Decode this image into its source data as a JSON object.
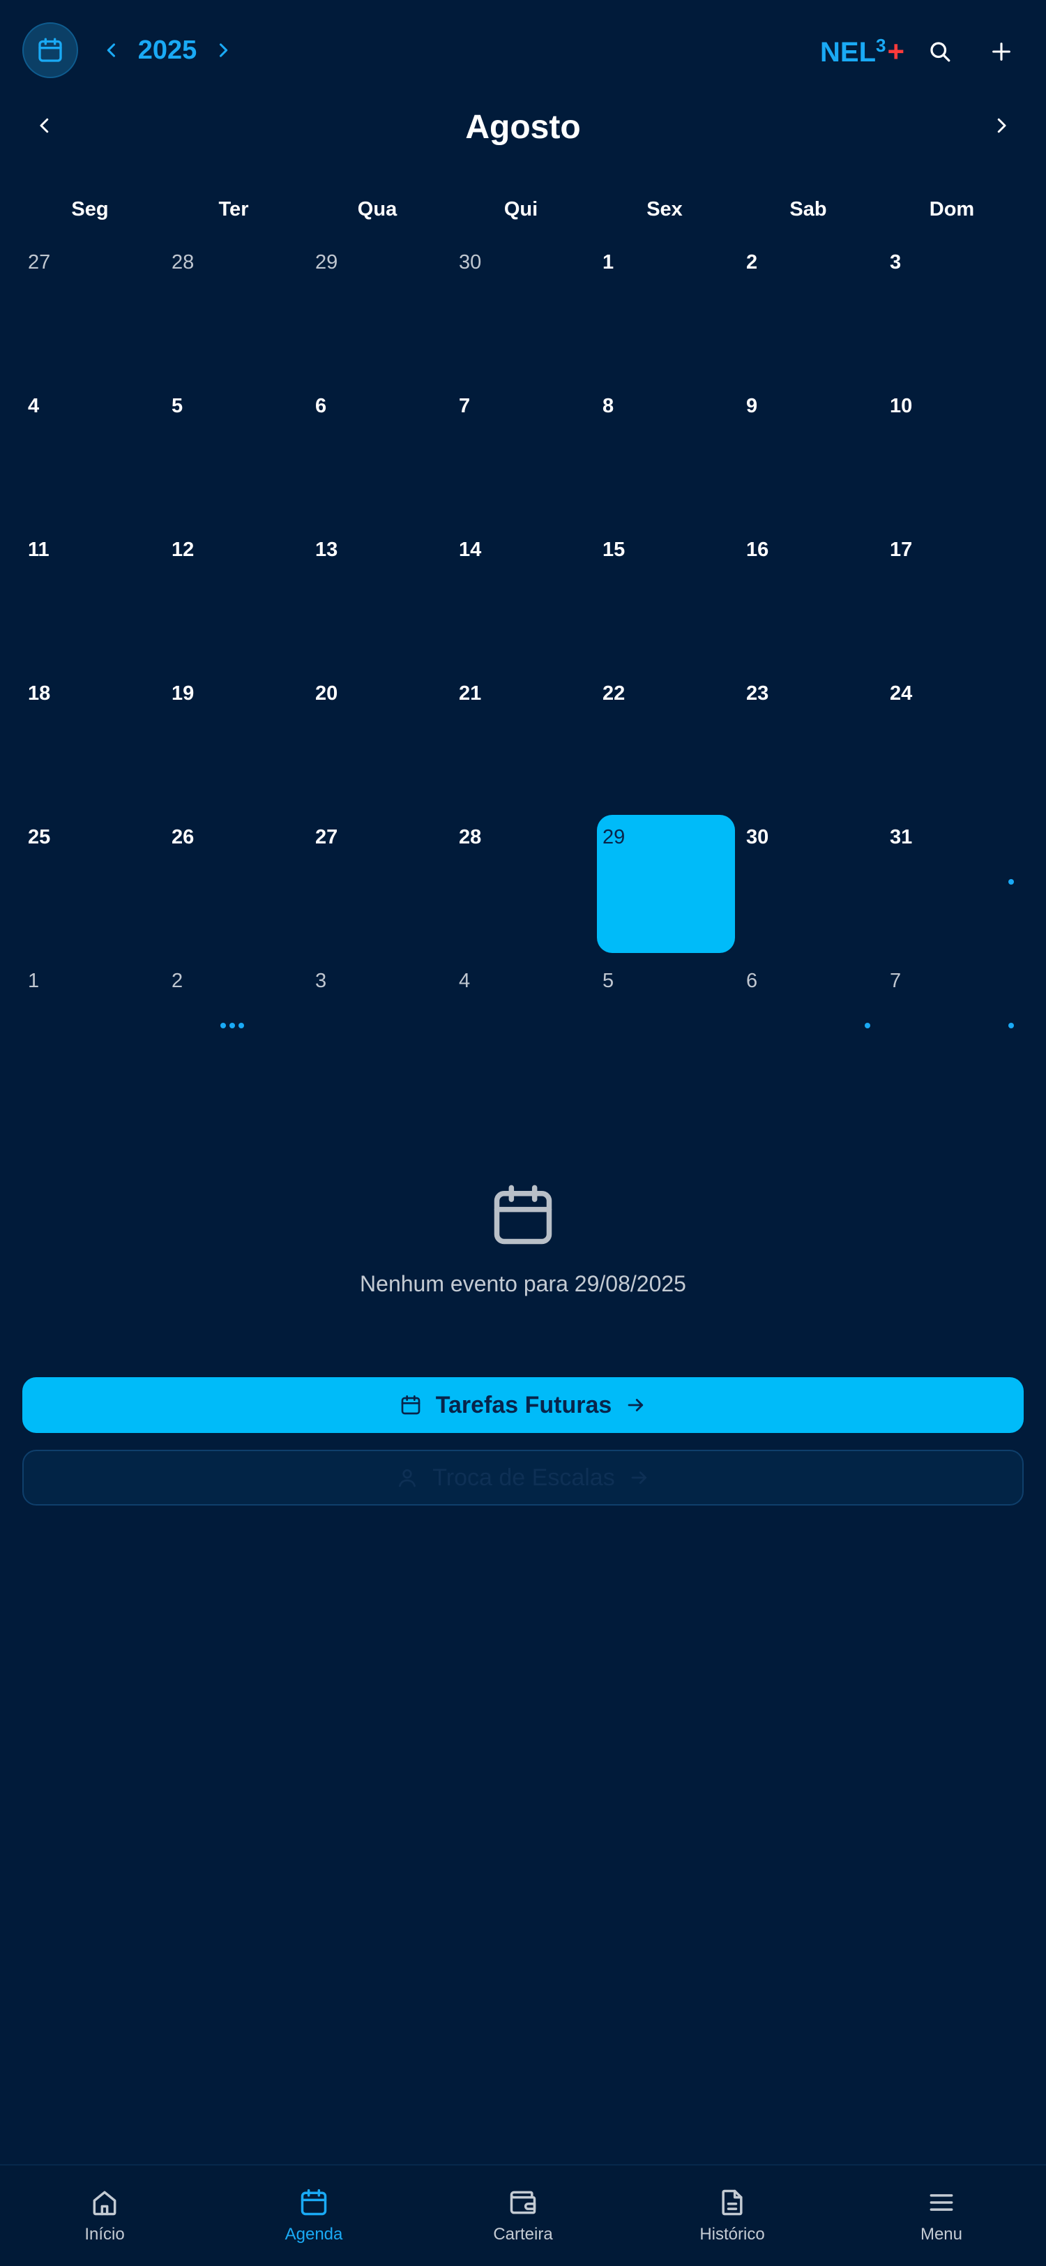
{
  "header": {
    "year": "2025",
    "brand_name": "NEL",
    "brand_sup": "3",
    "brand_plus": "+",
    "icons": {
      "calendar": "calendar-icon",
      "prev": "chevron-left-icon",
      "next": "chevron-right-icon",
      "search": "search-icon",
      "add": "plus-icon"
    },
    "accent_color": "#1aaaf5",
    "brand_plus_color": "#ff3b3b"
  },
  "month": {
    "title": "Agosto"
  },
  "weekdays": [
    "Seg",
    "Ter",
    "Qua",
    "Qui",
    "Sex",
    "Sab",
    "Dom"
  ],
  "calendar": {
    "selected_color": "#00bbf9",
    "event_dot_color": "#1aaaf5",
    "days": [
      {
        "n": "27",
        "other": true
      },
      {
        "n": "28",
        "other": true
      },
      {
        "n": "29",
        "other": true
      },
      {
        "n": "30",
        "other": true
      },
      {
        "n": "1"
      },
      {
        "n": "2"
      },
      {
        "n": "3"
      },
      {
        "n": "4"
      },
      {
        "n": "5"
      },
      {
        "n": "6"
      },
      {
        "n": "7"
      },
      {
        "n": "8"
      },
      {
        "n": "9"
      },
      {
        "n": "10"
      },
      {
        "n": "11"
      },
      {
        "n": "12"
      },
      {
        "n": "13"
      },
      {
        "n": "14"
      },
      {
        "n": "15"
      },
      {
        "n": "16"
      },
      {
        "n": "17"
      },
      {
        "n": "18"
      },
      {
        "n": "19"
      },
      {
        "n": "20"
      },
      {
        "n": "21"
      },
      {
        "n": "22"
      },
      {
        "n": "23"
      },
      {
        "n": "24"
      },
      {
        "n": "25"
      },
      {
        "n": "26"
      },
      {
        "n": "27"
      },
      {
        "n": "28"
      },
      {
        "n": "29",
        "selected": true
      },
      {
        "n": "30"
      },
      {
        "n": "31",
        "dots": 1
      },
      {
        "n": "1",
        "other": true
      },
      {
        "n": "2",
        "other": true,
        "dots": 3
      },
      {
        "n": "3",
        "other": true
      },
      {
        "n": "4",
        "other": true
      },
      {
        "n": "5",
        "other": true
      },
      {
        "n": "6",
        "other": true,
        "dots": 1
      },
      {
        "n": "7",
        "other": true,
        "dots": 1
      }
    ]
  },
  "empty_state": {
    "icon": "calendar-icon",
    "text": "Nenhum evento para 29/08/2025"
  },
  "buttons": {
    "future_tasks": "Tarefas Futuras",
    "swap_shifts": "Troca de Escalas"
  },
  "nav": {
    "items": [
      {
        "label": "Início",
        "icon": "home-icon"
      },
      {
        "label": "Agenda",
        "icon": "calendar-icon",
        "active": true
      },
      {
        "label": "Carteira",
        "icon": "wallet-icon"
      },
      {
        "label": "Histórico",
        "icon": "document-icon"
      },
      {
        "label": "Menu",
        "icon": "menu-icon"
      }
    ]
  }
}
